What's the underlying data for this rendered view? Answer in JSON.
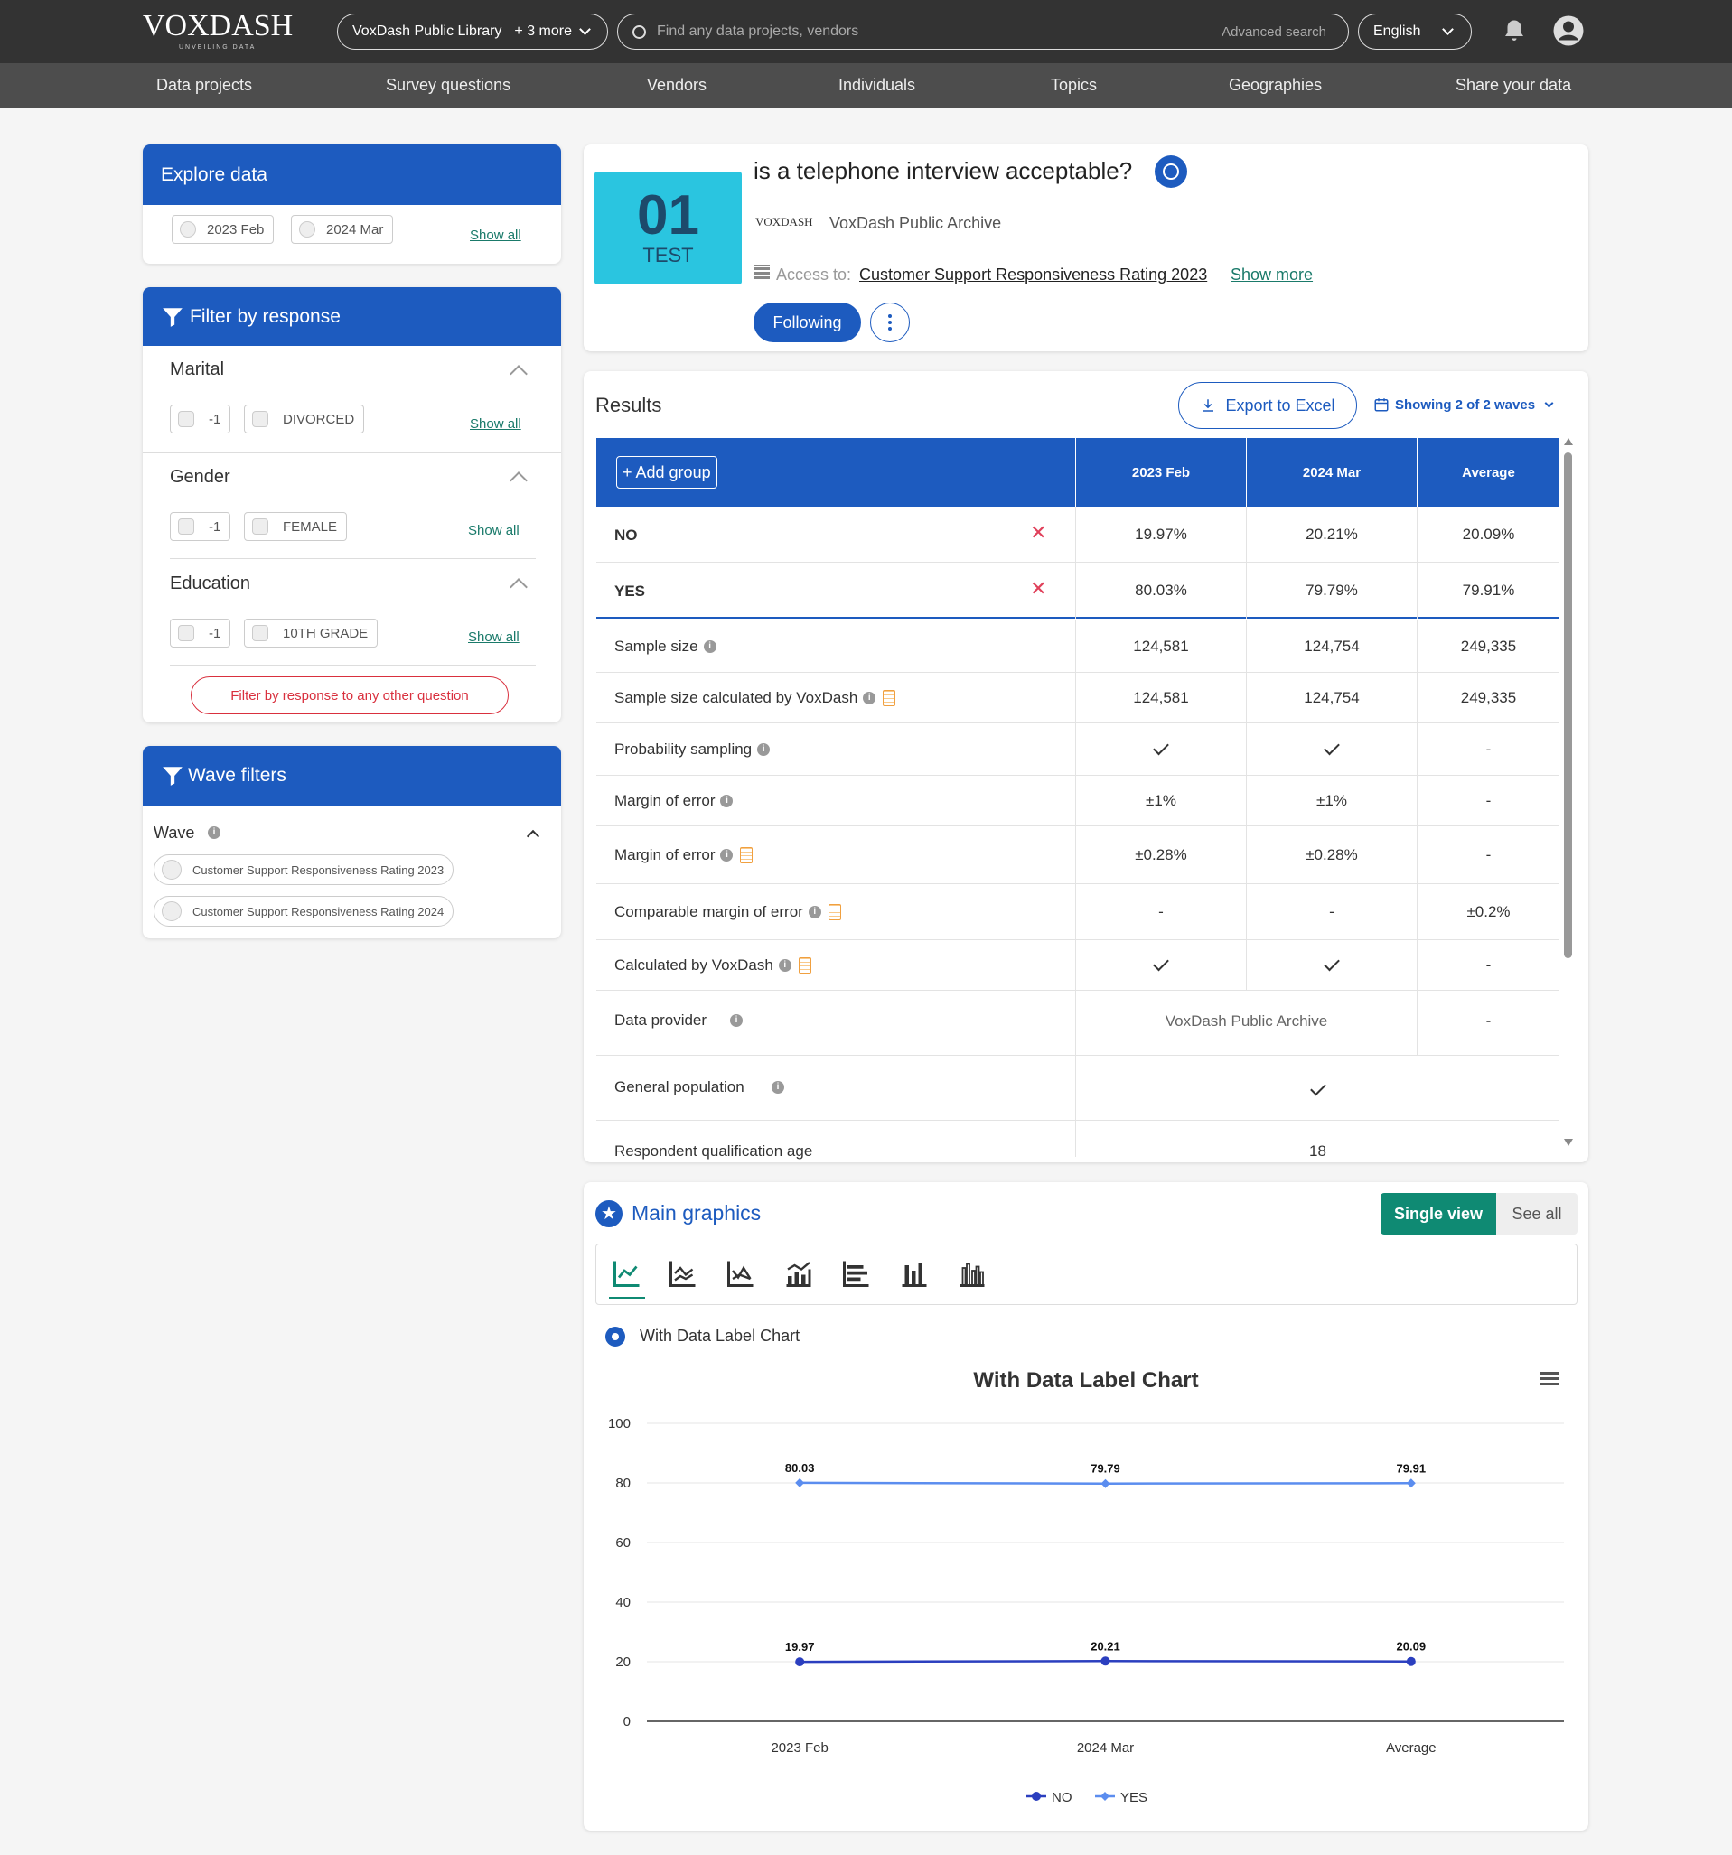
{
  "header": {
    "logo": "VOXDASH",
    "logo_sub": "UNVEILING DATA",
    "library": "VoxDash Public Library",
    "library_more": "+ 3 more",
    "search_placeholder": "Find any data projects, vendors",
    "advanced_search": "Advanced search",
    "language": "English"
  },
  "nav": [
    "Data projects",
    "Survey questions",
    "Vendors",
    "Individuals",
    "Topics",
    "Geographies",
    "Share your data"
  ],
  "explore": {
    "title": "Explore data",
    "chips": [
      "2023 Feb",
      "2024 Mar"
    ],
    "show_all": "Show all"
  },
  "filter": {
    "title": "Filter by response",
    "sections": [
      {
        "title": "Marital",
        "chips": [
          "-1",
          "DIVORCED"
        ],
        "show_all": "Show all"
      },
      {
        "title": "Gender",
        "chips": [
          "-1",
          "FEMALE"
        ],
        "show_all": "Show all"
      },
      {
        "title": "Education",
        "chips": [
          "-1",
          "10TH GRADE"
        ],
        "show_all": "Show all"
      }
    ],
    "other_button": "Filter by response to any other question"
  },
  "wave_filters": {
    "title": "Wave filters",
    "wave_label": "Wave",
    "options": [
      "Customer Support Responsiveness Rating 2023",
      "Customer Support Responsiveness Rating 2024"
    ]
  },
  "question": {
    "badge_num": "01",
    "badge_text": "TEST",
    "title": "is a telephone interview acceptable?",
    "vendor_logo": "VOXDASH",
    "vendor": "VoxDash Public Archive",
    "access_label": "Access to:",
    "access_link": "Customer Support Responsiveness Rating 2023",
    "show_more": "Show more",
    "following": "Following"
  },
  "results": {
    "title": "Results",
    "export": "Export to Excel",
    "waves": "Showing 2 of 2 waves",
    "add_group": "+ Add group",
    "columns": [
      "2023 Feb",
      "2024 Mar",
      "Average"
    ],
    "answers": [
      {
        "label": "NO",
        "values": [
          "19.97%",
          "20.21%",
          "20.09%"
        ]
      },
      {
        "label": "YES",
        "values": [
          "80.03%",
          "79.79%",
          "79.91%"
        ]
      }
    ],
    "meta": [
      {
        "label": "Sample size",
        "values": [
          "124,581",
          "124,754",
          "249,335"
        ]
      },
      {
        "label": "Sample size calculated by VoxDash",
        "values": [
          "124,581",
          "124,754",
          "249,335"
        ]
      },
      {
        "label": "Probability sampling",
        "values": [
          "check",
          "check",
          "-"
        ]
      },
      {
        "label": "Margin of error",
        "values": [
          "±1%",
          "±1%",
          "-"
        ]
      },
      {
        "label": "Margin of error",
        "values": [
          "±0.28%",
          "±0.28%",
          "-"
        ]
      },
      {
        "label": "Comparable margin of error",
        "values": [
          "-",
          "-",
          "±0.2%"
        ]
      },
      {
        "label": "Calculated by VoxDash",
        "values": [
          "check",
          "check",
          "-"
        ]
      }
    ],
    "data_provider_label": "Data provider",
    "data_provider": "VoxDash Public Archive",
    "data_provider_avg": "-",
    "general_population": "General population",
    "respondent_age": "Respondent qualification age",
    "respondent_age_value": "18"
  },
  "graphics": {
    "title": "Main graphics",
    "single_view": "Single view",
    "see_all": "See all",
    "chart_option_label": "With Data Label Chart"
  },
  "chart_data": {
    "type": "line",
    "title": "With Data Label Chart",
    "categories": [
      "2023 Feb",
      "2024 Mar",
      "Average"
    ],
    "series": [
      {
        "name": "NO",
        "values": [
          19.97,
          20.21,
          20.09
        ],
        "color": "#2b3fbf"
      },
      {
        "name": "YES",
        "values": [
          80.03,
          79.79,
          79.91
        ],
        "color": "#5b8def"
      }
    ],
    "ylim": [
      0,
      100
    ],
    "yticks": [
      0,
      20,
      40,
      60,
      80,
      100
    ],
    "grid": true,
    "legend": "bottom"
  },
  "colors": {
    "primary": "#1d5bbf",
    "accent": "#0f8a73",
    "danger": "#d9303e"
  }
}
